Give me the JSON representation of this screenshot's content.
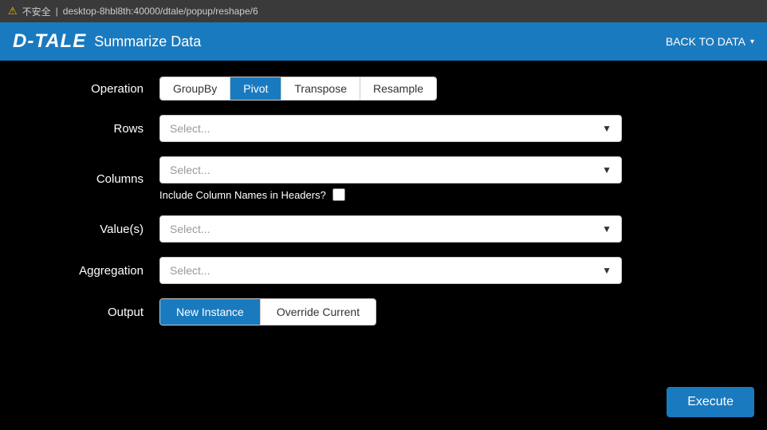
{
  "browser": {
    "warning": "⚠",
    "security_text": "不安全",
    "url": "desktop-8hbl8th:40000/dtale/popup/reshape/6"
  },
  "header": {
    "logo": "D-TALE",
    "title": "Summarize Data",
    "back_label": "BACK TO DATA",
    "caret": "▾"
  },
  "operation": {
    "label": "Operation",
    "buttons": [
      {
        "id": "groupby",
        "label": "GroupBy",
        "active": false
      },
      {
        "id": "pivot",
        "label": "Pivot",
        "active": true
      },
      {
        "id": "transpose",
        "label": "Transpose",
        "active": false
      },
      {
        "id": "resample",
        "label": "Resample",
        "active": false
      }
    ]
  },
  "rows": {
    "label": "Rows",
    "placeholder": "Select..."
  },
  "columns": {
    "label": "Columns",
    "placeholder": "Select...",
    "include_names_label": "Include Column Names in Headers?"
  },
  "values": {
    "label": "Value(s)",
    "placeholder": "Select..."
  },
  "aggregation": {
    "label": "Aggregation",
    "placeholder": "Select..."
  },
  "output": {
    "label": "Output",
    "buttons": [
      {
        "id": "new-instance",
        "label": "New Instance",
        "active": true
      },
      {
        "id": "override-current",
        "label": "Override Current",
        "active": false
      }
    ]
  },
  "execute": {
    "label": "Execute"
  },
  "dropdown_arrow": "▼"
}
